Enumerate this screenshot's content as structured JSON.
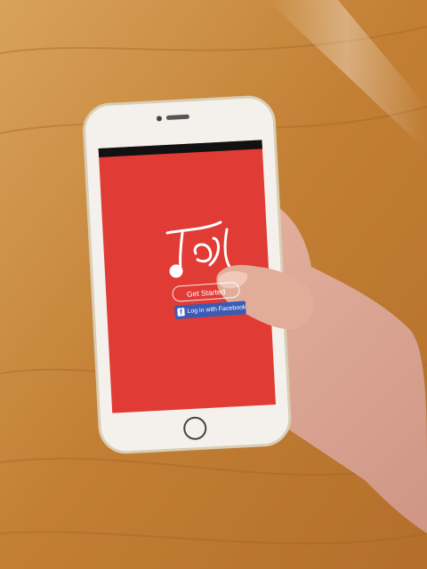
{
  "app": {
    "logo_text": "Jest",
    "get_started_label": "Get Started",
    "facebook_login_label": "Log in with Facebook",
    "facebook_icon": "f",
    "brand_color": "#e03b34"
  },
  "colors": {
    "table": "#c98a3f",
    "phone_body": "#f4f1ec",
    "facebook_blue": "#3b5bb5"
  }
}
